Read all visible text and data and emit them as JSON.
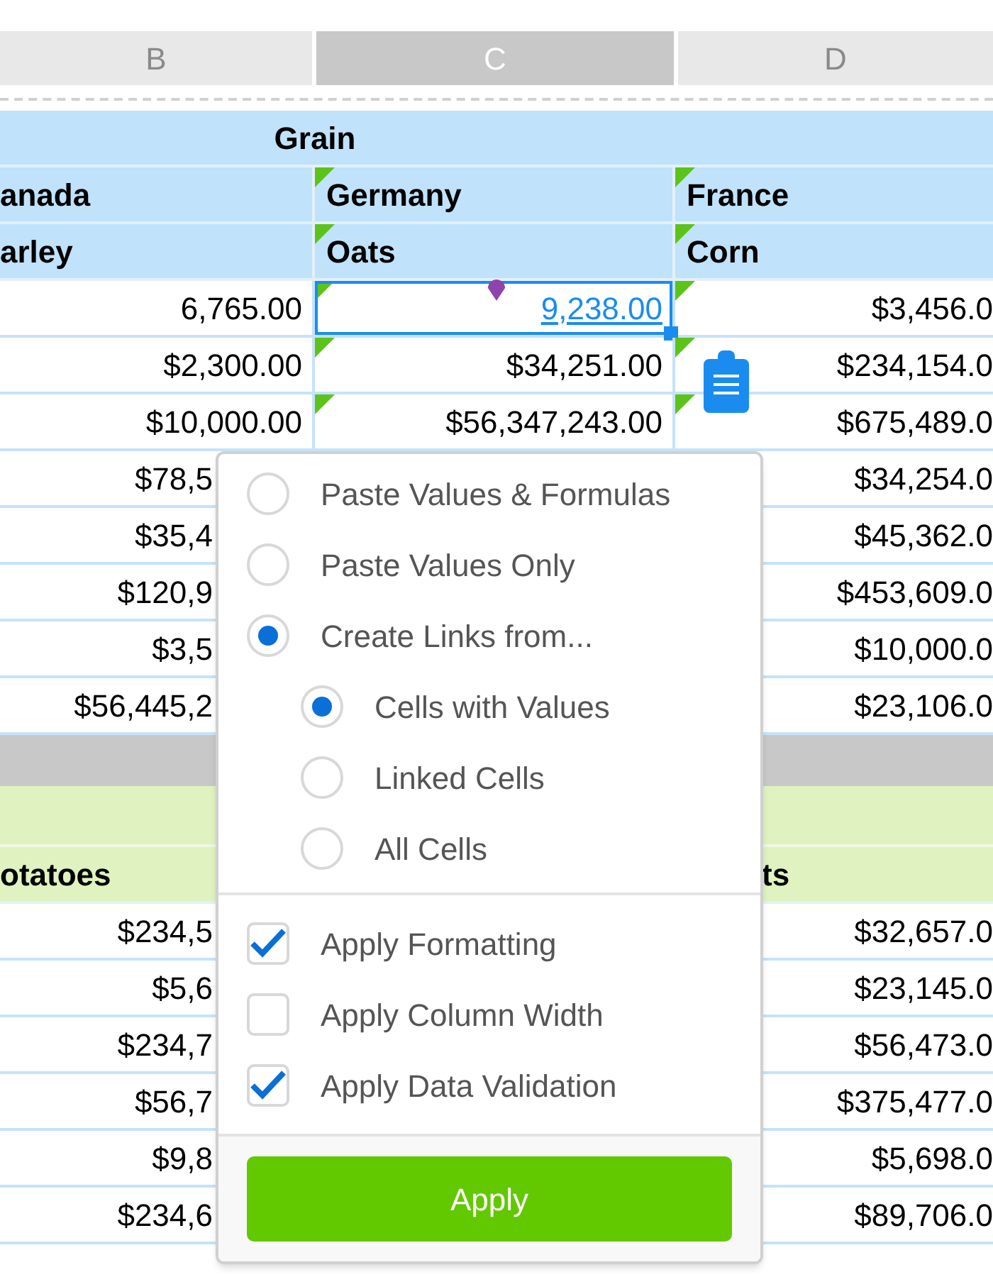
{
  "column_headers": [
    {
      "label": "B",
      "selected": false
    },
    {
      "label": "C",
      "selected": true
    },
    {
      "label": "D",
      "selected": false
    }
  ],
  "table_1": {
    "title": "Grain",
    "header_rows": [
      {
        "b": {
          "text": "anada",
          "flag": false
        },
        "c": {
          "text": "Germany",
          "flag": true
        },
        "d": {
          "text": "France",
          "flag": true
        }
      },
      {
        "b": {
          "text": "arley",
          "flag": false
        },
        "c": {
          "text": "Oats",
          "flag": true
        },
        "d": {
          "text": "Corn",
          "flag": true
        }
      }
    ],
    "rows": [
      {
        "b": {
          "text": "6,765.00",
          "flag": false
        },
        "c": {
          "text": "9,238.00",
          "flag": true,
          "selected": true
        },
        "d": {
          "text": "$3,456.0",
          "flag": true
        }
      },
      {
        "b": {
          "text": "$2,300.00",
          "flag": false
        },
        "c": {
          "text": "$34,251.00",
          "flag": true,
          "selected": false
        },
        "d": {
          "text": "$234,154.0",
          "flag": true
        }
      },
      {
        "b": {
          "text": "$10,000.00",
          "flag": false
        },
        "c": {
          "text": "$56,347,243.00",
          "flag": true,
          "selected": false
        },
        "d": {
          "text": "$675,489.0",
          "flag": true
        }
      },
      {
        "b": {
          "text": "$78,5",
          "flag": false
        },
        "d": {
          "text": "$34,254.0",
          "flag": false
        }
      },
      {
        "b": {
          "text": "$35,4",
          "flag": false
        },
        "d": {
          "text": "$45,362.0",
          "flag": false
        }
      },
      {
        "b": {
          "text": "$120,9",
          "flag": false
        },
        "d": {
          "text": "$453,609.0",
          "flag": false
        }
      },
      {
        "b": {
          "text": "$3,5",
          "flag": false
        },
        "d": {
          "text": "$10,000.0",
          "flag": false
        }
      },
      {
        "b": {
          "text": "$56,445,2",
          "flag": false
        },
        "d": {
          "text": "$23,106.0",
          "flag": false
        }
      }
    ]
  },
  "table_2": {
    "header_row": {
      "b": {
        "text": "otatoes",
        "flag": false
      },
      "d": {
        "text": "ts",
        "flag": false
      }
    },
    "rows": [
      {
        "b": {
          "text": "$234,5",
          "flag": false
        },
        "d": {
          "text": "$32,657.0",
          "flag": false
        }
      },
      {
        "b": {
          "text": "$5,6",
          "flag": false
        },
        "d": {
          "text": "$23,145.0",
          "flag": false
        }
      },
      {
        "b": {
          "text": "$234,7",
          "flag": false
        },
        "d": {
          "text": "$56,473.0",
          "flag": false
        }
      },
      {
        "b": {
          "text": "$56,7",
          "flag": false
        },
        "d": {
          "text": "$375,477.0",
          "flag": false
        }
      },
      {
        "b": {
          "text": "$9,8",
          "flag": false
        },
        "d": {
          "text": "$5,698.0",
          "flag": false
        }
      },
      {
        "b": {
          "text": "$234,6",
          "flag": false
        },
        "d": {
          "text": "$89,706.0",
          "flag": false
        }
      }
    ]
  },
  "paste_menu": {
    "options": [
      {
        "label": "Paste Values & Formulas",
        "selected": false
      },
      {
        "label": "Paste Values Only",
        "selected": false
      },
      {
        "label": "Create Links from...",
        "selected": true,
        "children": [
          {
            "label": "Cells with Values",
            "selected": true
          },
          {
            "label": "Linked Cells",
            "selected": false
          },
          {
            "label": "All Cells",
            "selected": false
          }
        ]
      }
    ],
    "checkboxes": [
      {
        "label": "Apply Formatting",
        "checked": true
      },
      {
        "label": "Apply Column Width",
        "checked": false
      },
      {
        "label": "Apply Data Validation",
        "checked": true
      }
    ],
    "button": "Apply"
  }
}
